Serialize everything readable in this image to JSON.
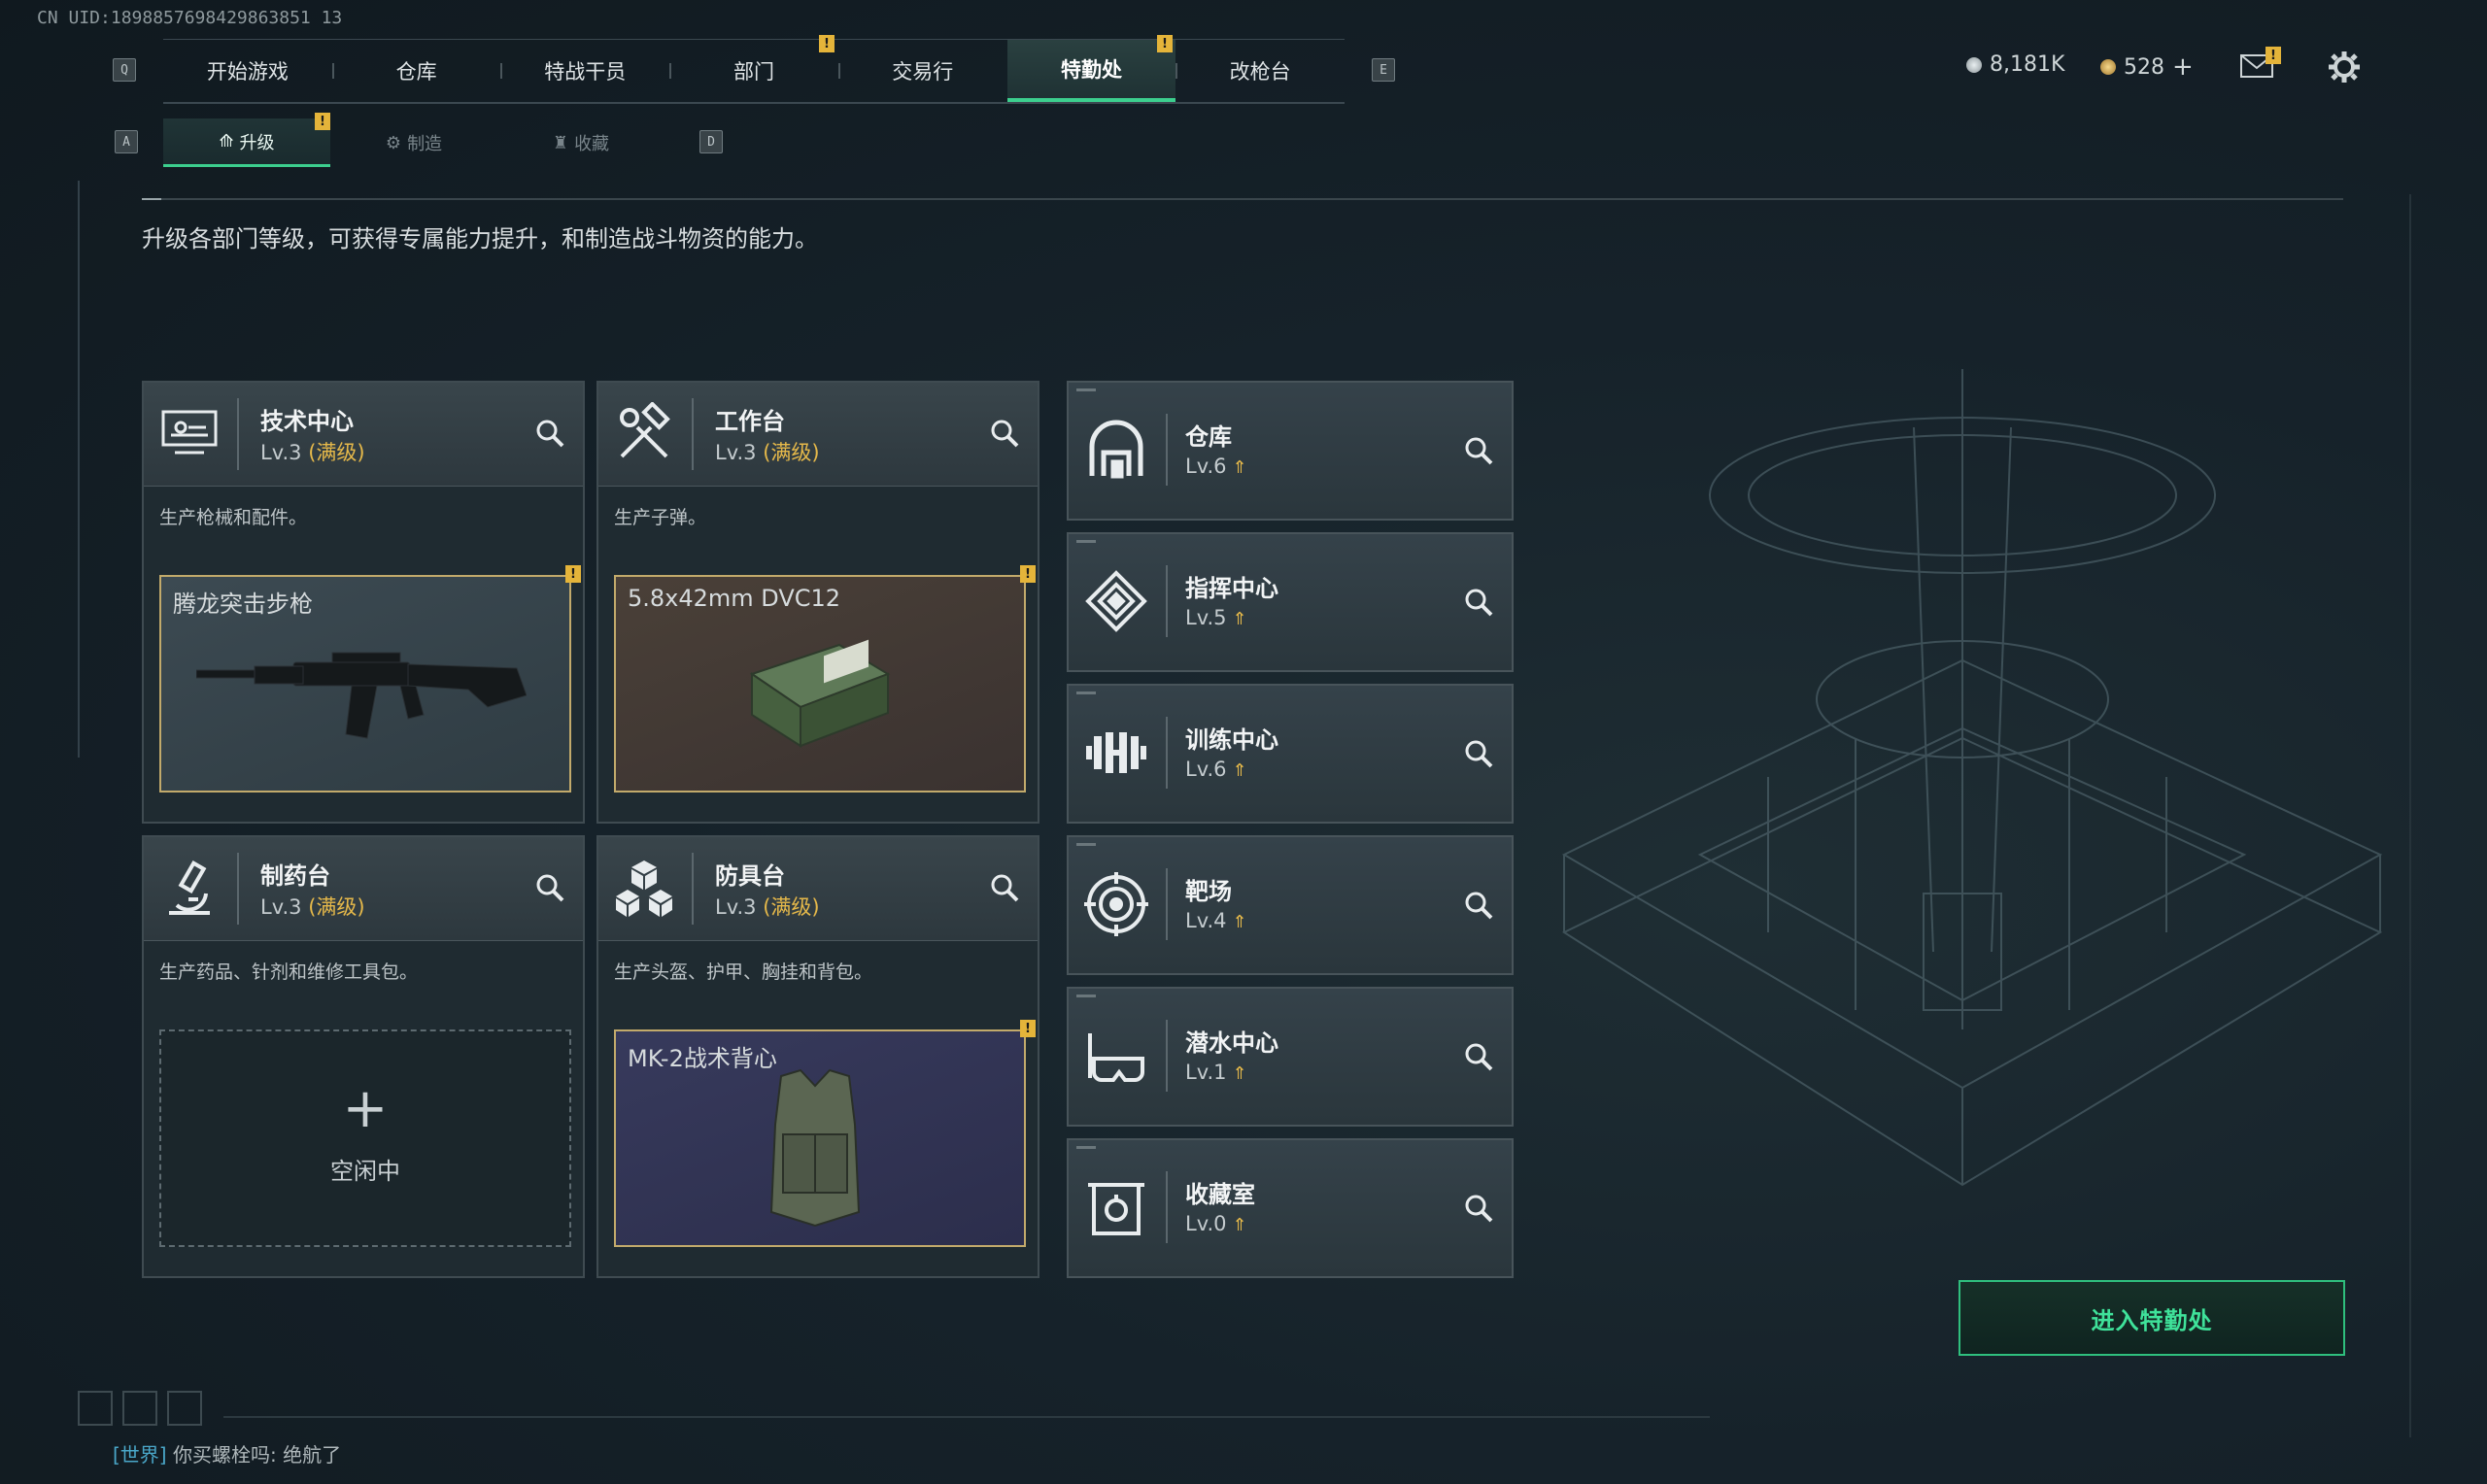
{
  "uid": "CN UID:1898857698429863851 13",
  "nav": {
    "left_key": "Q",
    "right_key": "E",
    "tabs": [
      "开始游戏",
      "仓库",
      "特战干员",
      "部门",
      "交易行",
      "特勤处",
      "改枪台"
    ],
    "active": "特勤处"
  },
  "subnav": {
    "left_key": "A",
    "right_key": "D",
    "tabs": [
      "升级",
      "制造",
      "收藏"
    ],
    "active": "升级"
  },
  "currency": {
    "silver": "8,181K",
    "gold": "528"
  },
  "description": "升级各部门等级，可获得专属能力提升，和制造战斗物资的能力。",
  "workshops": [
    {
      "name": "技术中心",
      "level": "Lv.3",
      "max": "(满级)",
      "desc": "生产枪械和配件。",
      "slot": "腾龙突击步枪",
      "slot_state": "item",
      "icon": "computer-icon"
    },
    {
      "name": "工作台",
      "level": "Lv.3",
      "max": "(满级)",
      "desc": "生产子弹。",
      "slot": "5.8x42mm DVC12",
      "slot_state": "item",
      "icon": "hammer-wrench-icon"
    },
    {
      "name": "制药台",
      "level": "Lv.3",
      "max": "(满级)",
      "desc": "生产药品、针剂和维修工具包。",
      "slot": "空闲中",
      "slot_state": "idle",
      "icon": "microscope-icon"
    },
    {
      "name": "防具台",
      "level": "Lv.3",
      "max": "(满级)",
      "desc": "生产头盔、护甲、胸挂和背包。",
      "slot": "MK-2战术背心",
      "slot_state": "item",
      "icon": "cubes-icon"
    }
  ],
  "facilities": [
    {
      "name": "仓库",
      "level": "Lv.6",
      "icon": "warehouse-icon"
    },
    {
      "name": "指挥中心",
      "level": "Lv.5",
      "icon": "command-icon"
    },
    {
      "name": "训练中心",
      "level": "Lv.6",
      "icon": "dumbbell-icon"
    },
    {
      "name": "靶场",
      "level": "Lv.4",
      "icon": "target-icon"
    },
    {
      "name": "潜水中心",
      "level": "Lv.1",
      "icon": "diving-mask-icon"
    },
    {
      "name": "收藏室",
      "level": "Lv.0",
      "icon": "collection-icon"
    }
  ],
  "enter_button": "进入特勤处",
  "chat": {
    "channel": "[世界]",
    "message": "你买螺栓吗: 绝航了"
  },
  "colors": {
    "accent_green": "#3ccf8e",
    "warning_yellow": "#e4b43a",
    "gold_text": "#e6b94a"
  }
}
